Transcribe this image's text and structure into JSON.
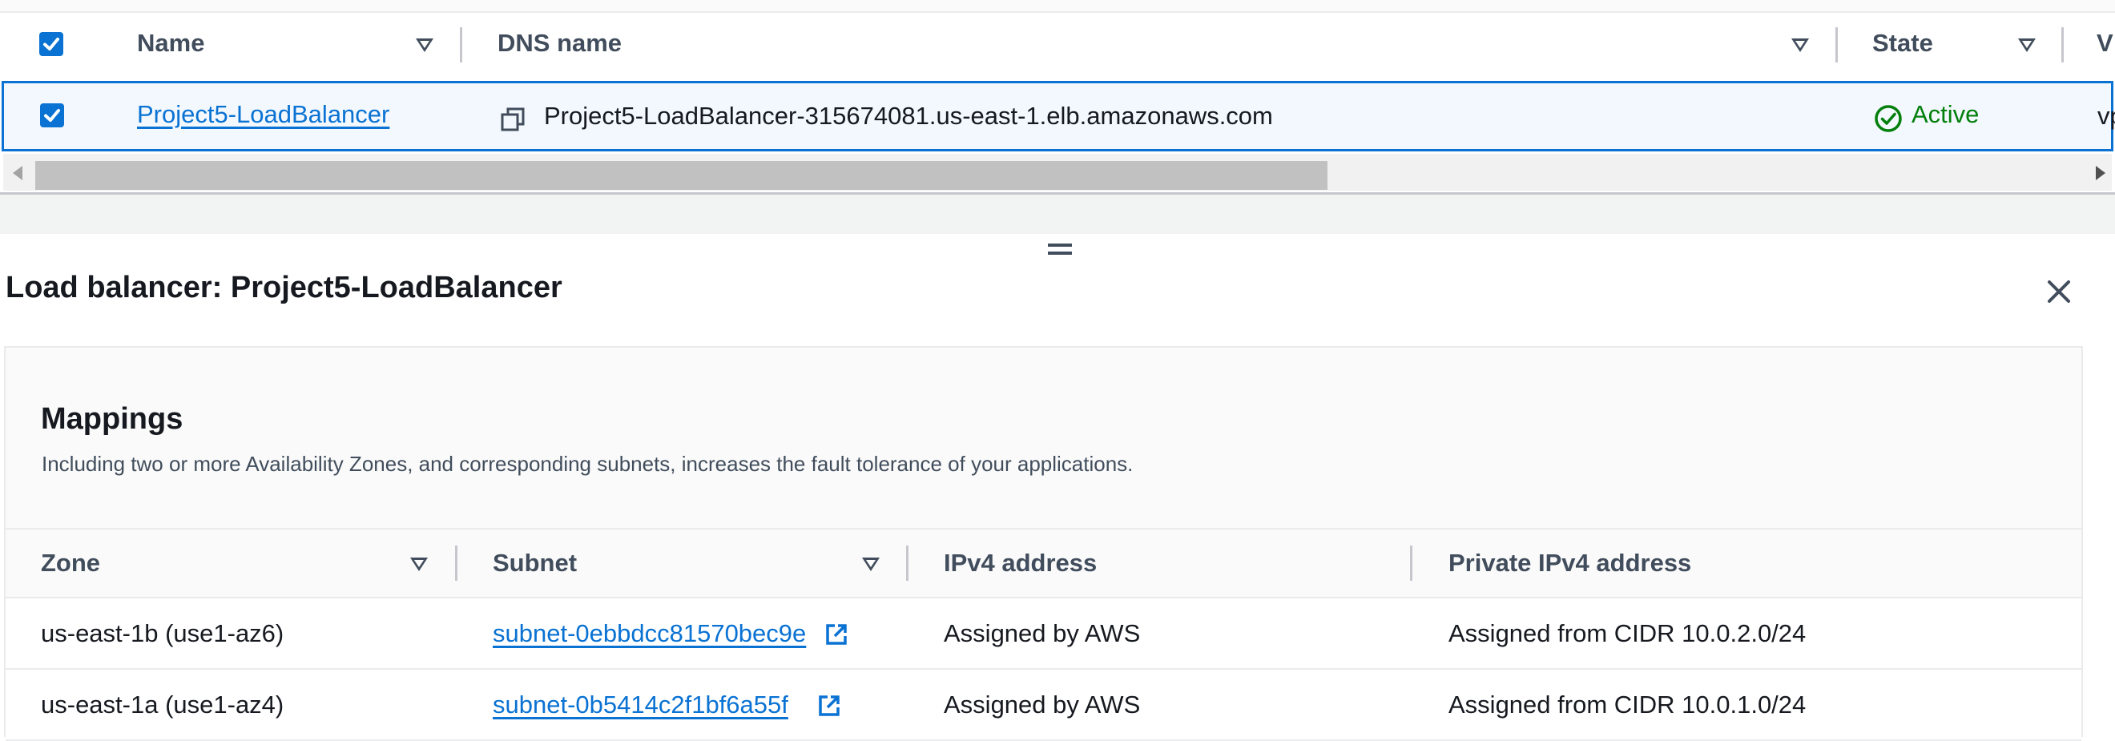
{
  "lb_table": {
    "columns": [
      {
        "label": "Name"
      },
      {
        "label": "DNS name"
      },
      {
        "label": "State"
      },
      {
        "label": "V"
      }
    ],
    "rows": [
      {
        "selected": true,
        "name": "Project5-LoadBalancer",
        "dns_name": "Project5-LoadBalancer-315674081.us-east-1.elb.amazonaws.com",
        "state": "Active",
        "vpc_partial": "vp"
      }
    ],
    "horizontal_scroll_fraction": 0.61
  },
  "split_panel": {
    "title": "Load balancer: Project5-LoadBalancer",
    "mappings": {
      "title": "Mappings",
      "description": "Including two or more Availability Zones, and corresponding subnets, increases the fault tolerance of your applications.",
      "columns": [
        {
          "label": "Zone"
        },
        {
          "label": "Subnet"
        },
        {
          "label": "IPv4 address"
        },
        {
          "label": "Private IPv4 address"
        }
      ],
      "rows": [
        {
          "zone": "us-east-1b (use1-az6)",
          "subnet": "subnet-0ebbdcc81570bec9e",
          "ipv4": "Assigned by AWS",
          "private_ipv4": "Assigned from CIDR 10.0.2.0/24"
        },
        {
          "zone": "us-east-1a (use1-az4)",
          "subnet": "subnet-0b5414c2f1bf6a55f",
          "ipv4": "Assigned by AWS",
          "private_ipv4": "Assigned from CIDR 10.0.1.0/24"
        }
      ]
    }
  },
  "colors": {
    "primary_blue": "#0972d3",
    "active_green": "#037f0c",
    "text_dark": "#16191f",
    "text_secondary": "#414d5c"
  },
  "icons": [
    "checkbox-checked",
    "filter-triangle",
    "copy-icon",
    "status-success-icon",
    "close-icon",
    "external-link-icon",
    "drag-handle-icon"
  ]
}
